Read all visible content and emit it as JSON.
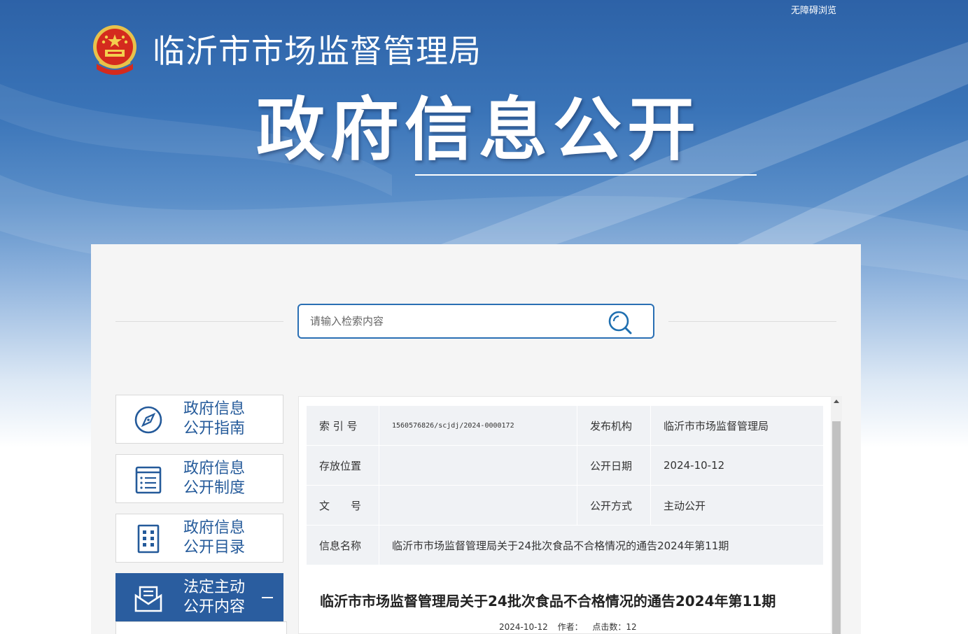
{
  "header": {
    "accessibility_link": "无障碍浏览",
    "site_title": "临沂市市场监督管理局",
    "page_title": "政府信息公开"
  },
  "search": {
    "placeholder": "请输入检索内容",
    "value": ""
  },
  "sidebar": {
    "items": [
      {
        "line1": "政府信息",
        "line2": "公开指南",
        "icon": "compass-icon",
        "active": false
      },
      {
        "line1": "政府信息",
        "line2": "公开制度",
        "icon": "list-document-icon",
        "active": false
      },
      {
        "line1": "政府信息",
        "line2": "公开目录",
        "icon": "directory-grid-icon",
        "active": false
      },
      {
        "line1": "法定主动",
        "line2": "公开内容",
        "icon": "envelope-document-icon",
        "active": true
      }
    ]
  },
  "info_table": {
    "index_label": "索 引 号",
    "index_value": "1560576826/scjdj/2024-0000172",
    "org_label": "发布机构",
    "org_value": "临沂市市场监督管理局",
    "location_label": "存放位置",
    "location_value": "",
    "date_label": "公开日期",
    "date_value": "2024-10-12",
    "doc_no_label": "文　　号",
    "doc_no_value": "",
    "method_label": "公开方式",
    "method_value": "主动公开",
    "name_label": "信息名称",
    "name_value": "临沂市市场监督管理局关于24批次食品不合格情况的通告2024年第11期"
  },
  "article": {
    "title": "临沂市市场监督管理局关于24批次食品不合格情况的通告2024年第11期",
    "date": "2024-10-12",
    "author": "作者：",
    "clicks": "点击数：12"
  },
  "colors": {
    "brand_blue": "#2a5d9f",
    "search_border": "#2a6fb4",
    "table_bg": "#f0f2f5"
  }
}
